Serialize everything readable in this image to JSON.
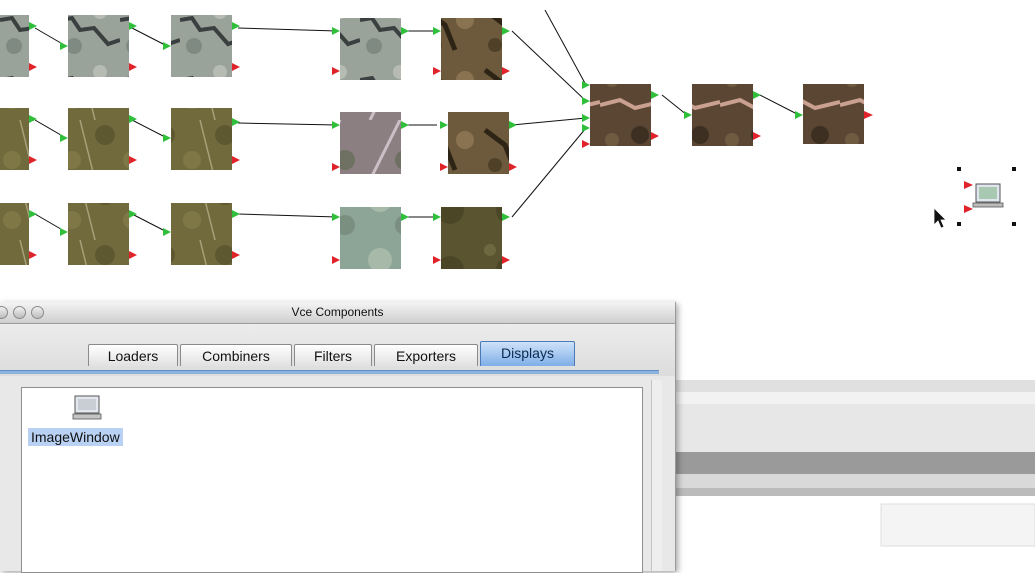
{
  "palette": {
    "title": "Vce Components",
    "tabs": [
      {
        "label": "Loaders",
        "active": false
      },
      {
        "label": "Combiners",
        "active": false
      },
      {
        "label": "Filters",
        "active": false
      },
      {
        "label": "Exporters",
        "active": false
      },
      {
        "label": "Displays",
        "active": true
      }
    ],
    "components": [
      {
        "label": "ImageWindow",
        "icon": "display-icon",
        "selected": true
      }
    ]
  },
  "colors": {
    "input_port": "#2fbf3a",
    "output_port": "#e0232a",
    "selected_tab": "#7eaee8",
    "selected_item": "#b9d2f3",
    "link_line": "#111111"
  },
  "workflow": {
    "rows": 3,
    "stages_per_row": 4,
    "combiner_nodes": 3,
    "display_node_selected": true
  }
}
